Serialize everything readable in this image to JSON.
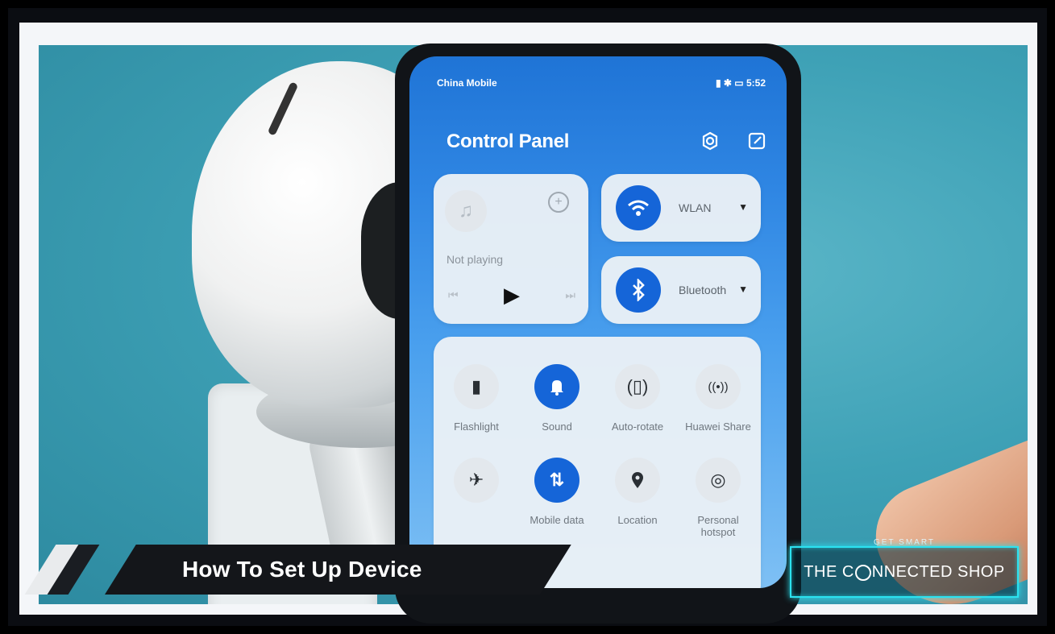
{
  "status_bar": {
    "carrier": "China Mobile",
    "right": "5:52"
  },
  "control_panel": {
    "title": "Control Panel",
    "icons": [
      "settings-icon",
      "edit-icon"
    ]
  },
  "media": {
    "status": "Not playing",
    "icons": [
      "music-note-icon",
      "add-circle-icon",
      "previous-icon",
      "play-icon",
      "next-icon"
    ]
  },
  "connections": {
    "wlan": {
      "label": "WLAN",
      "icon": "wifi-icon",
      "active": true
    },
    "bluetooth": {
      "label": "Bluetooth",
      "icon": "bluetooth-icon",
      "active": true
    }
  },
  "toggles": [
    {
      "label": "Flashlight",
      "icon": "flashlight-icon",
      "active": false
    },
    {
      "label": "Sound",
      "icon": "bell-icon",
      "active": true
    },
    {
      "label": "Auto-rotate",
      "icon": "rotate-icon",
      "active": false
    },
    {
      "label": "Huawei Share",
      "icon": "share-wave-icon",
      "active": false
    },
    {
      "label": "",
      "icon": "airplane-icon",
      "active": false
    },
    {
      "label": "Mobile data",
      "icon": "mobile-data-icon",
      "active": true
    },
    {
      "label": "Location",
      "icon": "location-pin-icon",
      "active": false
    },
    {
      "label": "Personal hotspot",
      "icon": "hotspot-icon",
      "active": false
    }
  ],
  "lower_third": {
    "title": "How To Set Up Device"
  },
  "brand": {
    "tagline": "GET SMART",
    "name_pre": "THE C",
    "name_post": "NNECTED SHOP"
  },
  "colors": {
    "accent": "#1565d8",
    "brand_glow": "#2be2f0",
    "background": "#3ea1b6"
  }
}
